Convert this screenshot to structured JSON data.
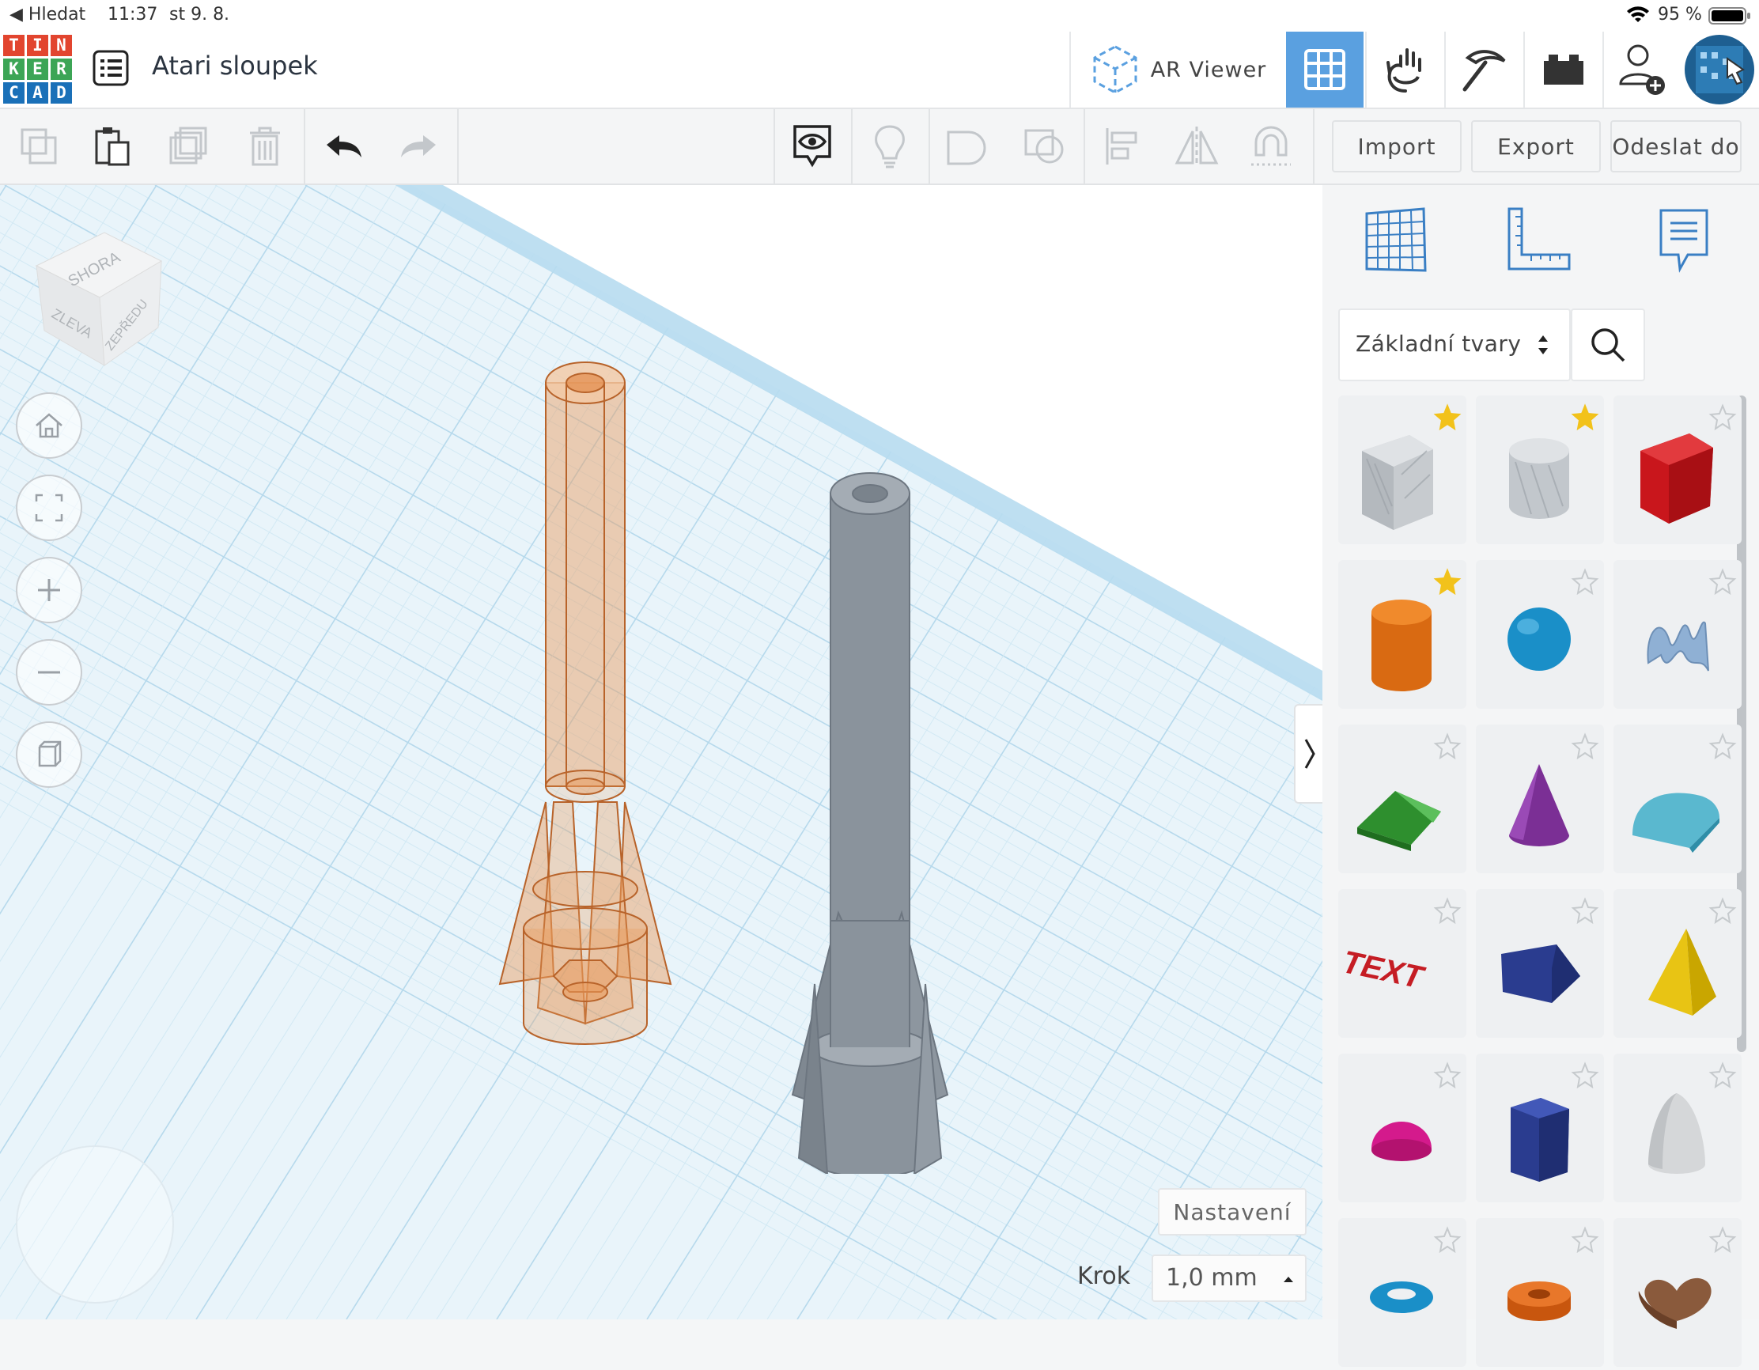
{
  "status_bar": {
    "back_app": "◀ Hledat",
    "time": "11:37",
    "date": "st 9. 8.",
    "battery": "95 %"
  },
  "header": {
    "logo_letters": [
      "T",
      "I",
      "N",
      "K",
      "E",
      "R",
      "C",
      "A",
      "D"
    ],
    "logo_colors": [
      "#e2452f",
      "#e2452f",
      "#e2452f",
      "#3ca556",
      "#3ca556",
      "#3ca556",
      "#1a70b8",
      "#1a70b8",
      "#1a70b8"
    ],
    "design_title": "Atari sloupek",
    "ar_viewer_label": "AR Viewer",
    "accent": "#5aa0e0"
  },
  "toolbar": {
    "import_label": "Import",
    "export_label": "Export",
    "send_label": "Odeslat do"
  },
  "viewcube": {
    "top": "SHORA",
    "left": "ZLEVA",
    "front": "ZEPŘEDU"
  },
  "workplane": {
    "settings_label": "Nastavení",
    "step_label": "Krok",
    "step_value": "1,0 mm"
  },
  "panel": {
    "library_select": "Základní tvary",
    "shapes": [
      {
        "name": "box-hole",
        "starred": true
      },
      {
        "name": "cylinder-hole",
        "starred": true
      },
      {
        "name": "box",
        "starred": false
      },
      {
        "name": "cylinder",
        "starred": true
      },
      {
        "name": "sphere",
        "starred": false
      },
      {
        "name": "scribble",
        "starred": false
      },
      {
        "name": "roof",
        "starred": false
      },
      {
        "name": "cone",
        "starred": false
      },
      {
        "name": "round-roof",
        "starred": false
      },
      {
        "name": "text",
        "starred": false
      },
      {
        "name": "wedge",
        "starred": false
      },
      {
        "name": "pyramid",
        "starred": false
      },
      {
        "name": "half-sphere",
        "starred": false
      },
      {
        "name": "polygon",
        "starred": false
      },
      {
        "name": "paraboloid",
        "starred": false
      },
      {
        "name": "torus",
        "starred": false
      },
      {
        "name": "tube",
        "starred": false
      },
      {
        "name": "heart",
        "starred": false
      }
    ],
    "text_shape_label": "TEXT"
  }
}
